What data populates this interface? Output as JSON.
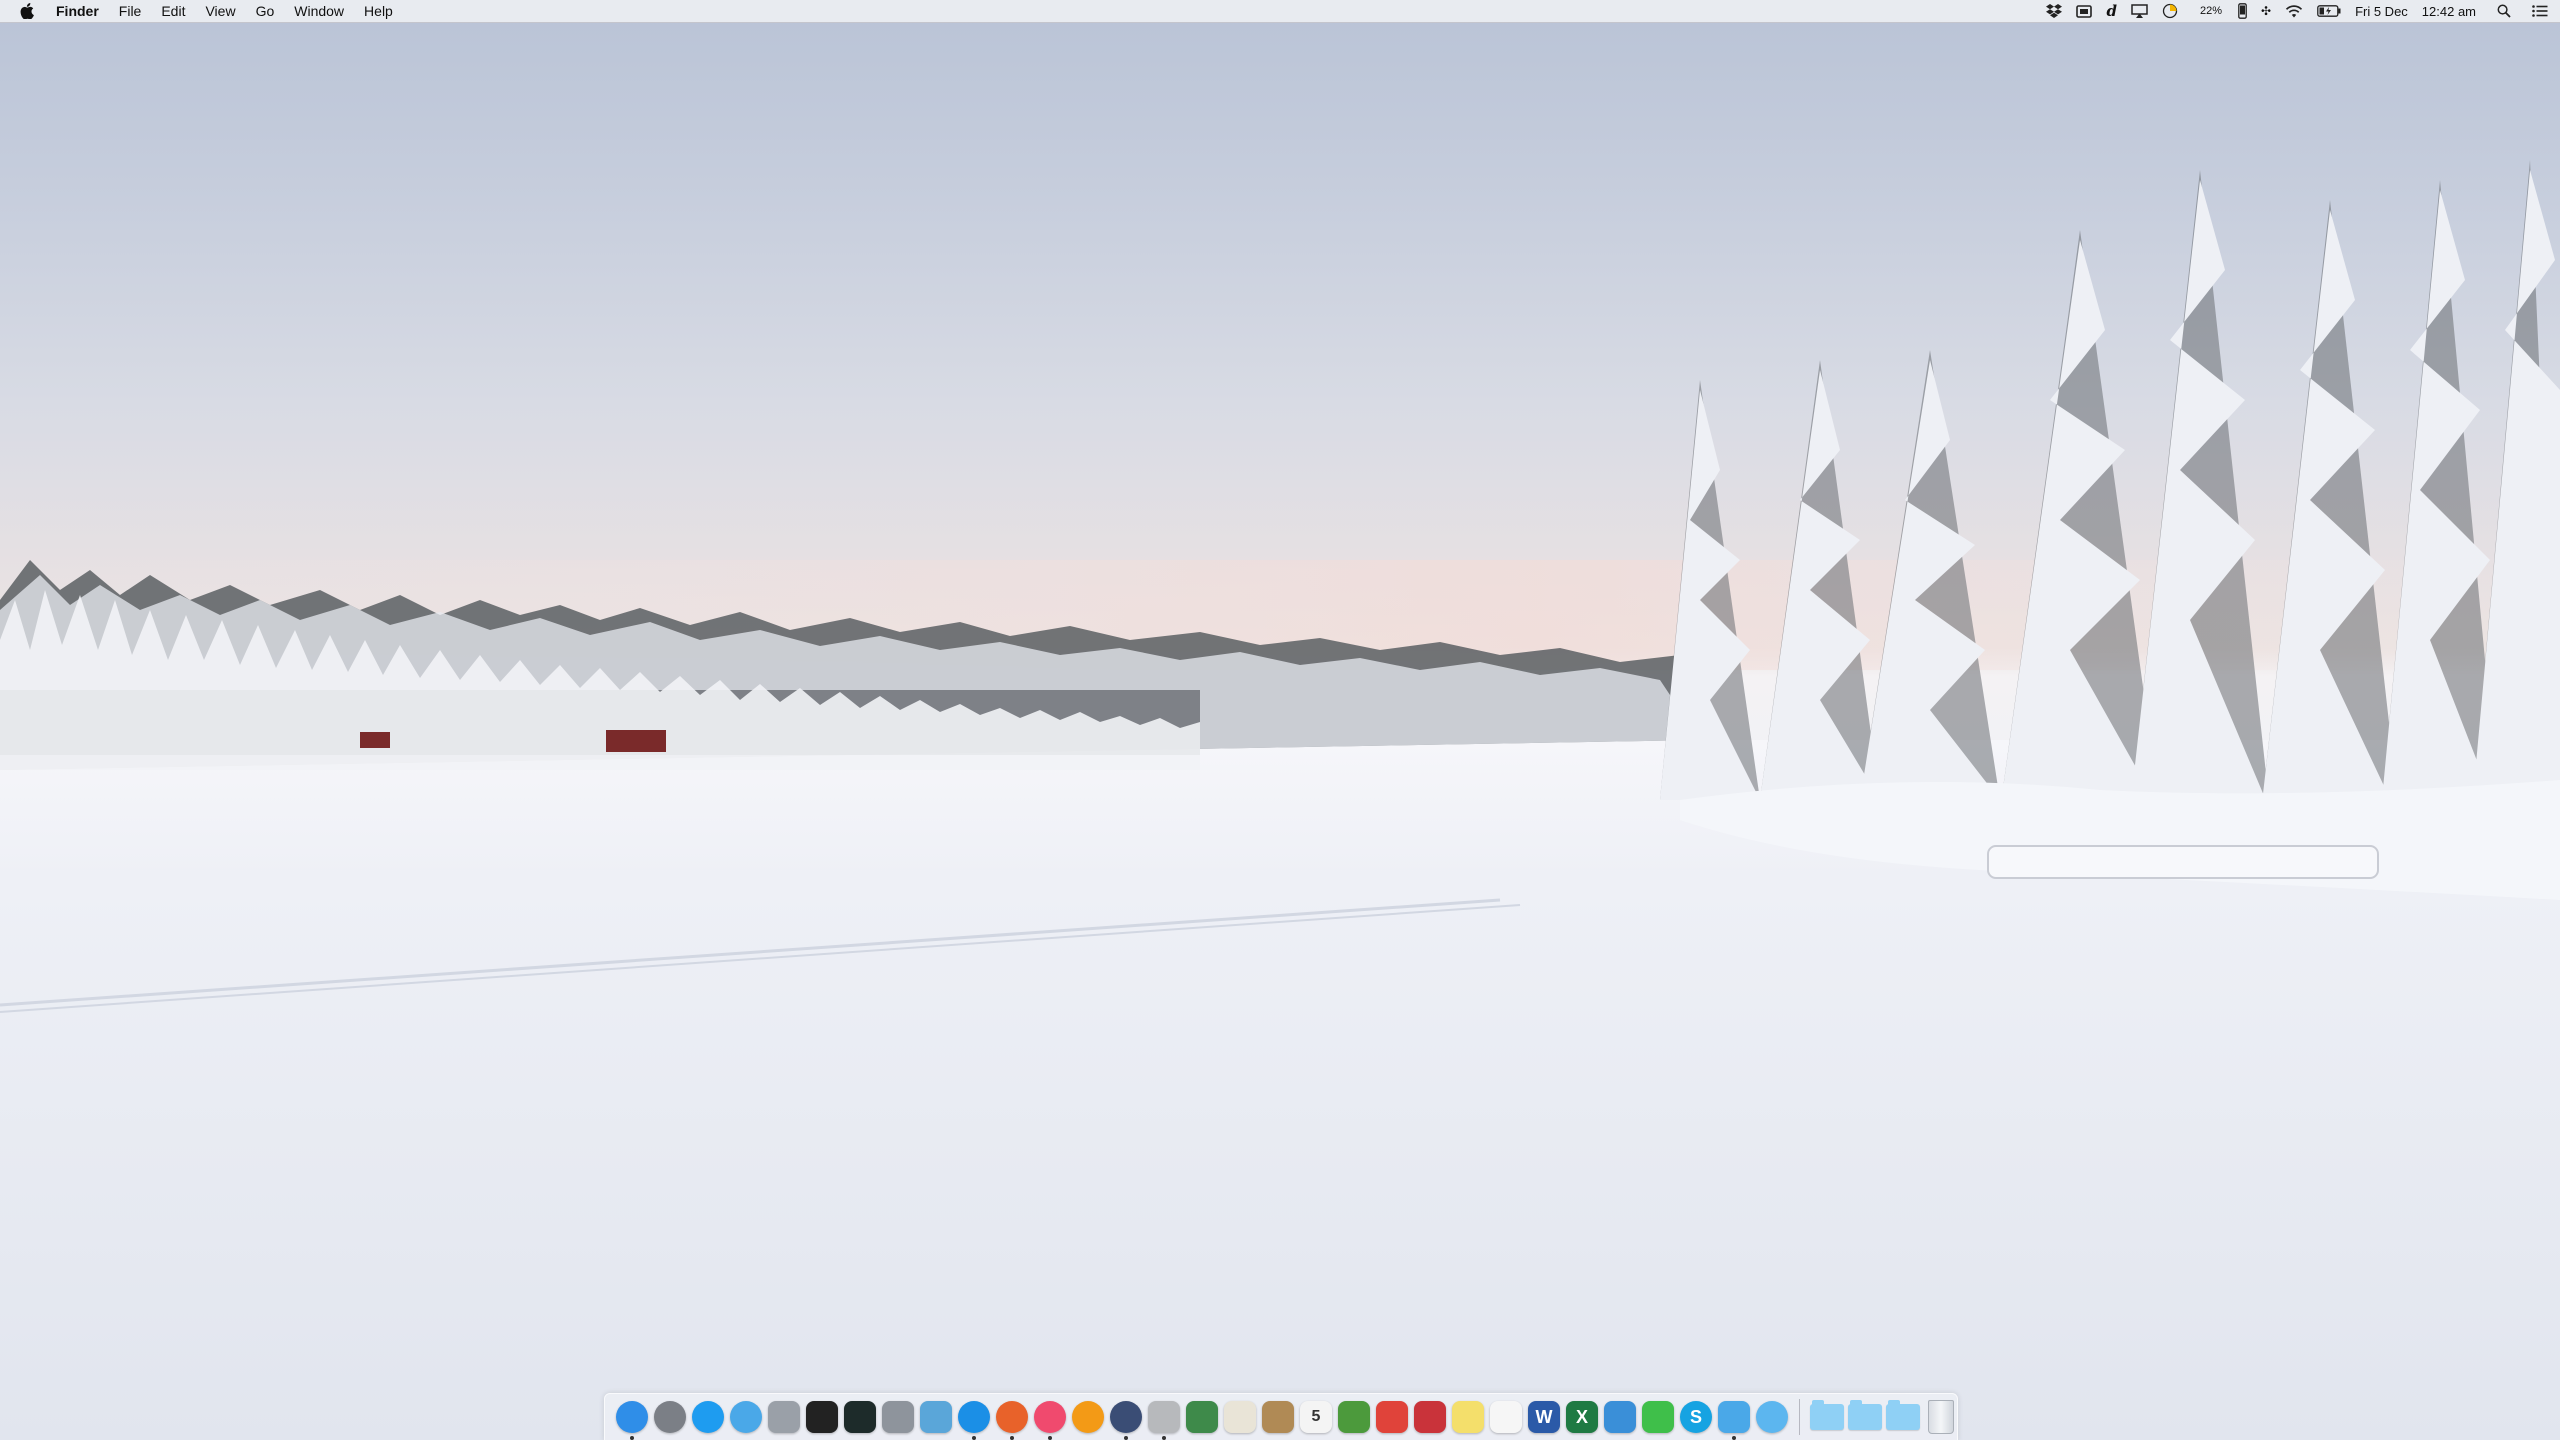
{
  "menubar": {
    "apple_icon": "apple-logo",
    "app_name": "Finder",
    "menus": [
      "File",
      "Edit",
      "View",
      "Go",
      "Window",
      "Help"
    ],
    "status": {
      "battery_percent": "22%",
      "date": "Fri 5 Dec",
      "time": "12:42 am",
      "icons": [
        "dropbox-icon",
        "screen-icon",
        "deezer-icon",
        "airplay-icon",
        "timer-icon",
        "phone-icon",
        "bluetooth-icon",
        "wifi-icon",
        "battery-icon",
        "spotlight-icon",
        "notification-center-icon"
      ]
    }
  },
  "dock": {
    "apps": [
      {
        "name": "finder",
        "running": true,
        "color": "#2f8ee8"
      },
      {
        "name": "system-preferences",
        "running": false,
        "color": "#7b7f86"
      },
      {
        "name": "app-store",
        "running": false,
        "color": "#1e9cf0"
      },
      {
        "name": "wifi-diagnostics",
        "running": false,
        "color": "#4aa8e8"
      },
      {
        "name": "printer",
        "running": false,
        "color": "#9aa0a8"
      },
      {
        "name": "terminal",
        "running": false,
        "color": "#222222"
      },
      {
        "name": "activity-monitor",
        "running": false,
        "color": "#1d2b2a"
      },
      {
        "name": "system-information",
        "running": false,
        "color": "#8e949c"
      },
      {
        "name": "preview",
        "running": false,
        "color": "#5aa6d9"
      },
      {
        "name": "safari",
        "running": true,
        "color": "#1b8fe6"
      },
      {
        "name": "firefox",
        "running": true,
        "color": "#e8622a"
      },
      {
        "name": "itunes",
        "running": true,
        "color": "#f04a6e"
      },
      {
        "name": "ibooks",
        "running": false,
        "color": "#f39a16"
      },
      {
        "name": "quicktime",
        "running": true,
        "color": "#3a4d75"
      },
      {
        "name": "script-editor",
        "running": true,
        "color": "#b7b9bc"
      },
      {
        "name": "photo-tool",
        "running": false,
        "color": "#3e8a4a"
      },
      {
        "name": "textedit",
        "running": false,
        "color": "#e9e4d7"
      },
      {
        "name": "contacts",
        "running": false,
        "color": "#b08a55"
      },
      {
        "name": "calendar",
        "running": false,
        "color": "#f4f4f4",
        "label": "5"
      },
      {
        "name": "vpn-app",
        "running": false,
        "color": "#4c9a3c"
      },
      {
        "name": "parallels",
        "running": false,
        "color": "#e0433a"
      },
      {
        "name": "pen-app",
        "running": false,
        "color": "#c9333a"
      },
      {
        "name": "stickies",
        "running": false,
        "color": "#f4df6b"
      },
      {
        "name": "notes",
        "running": false,
        "color": "#f6f6f6"
      },
      {
        "name": "word",
        "running": false,
        "color": "#2b5aa8",
        "label": "W"
      },
      {
        "name": "excel",
        "running": false,
        "color": "#1f7a43",
        "label": "X"
      },
      {
        "name": "keynote",
        "running": false,
        "color": "#3a8fd8"
      },
      {
        "name": "facetime",
        "running": false,
        "color": "#3fbf4a"
      },
      {
        "name": "skype",
        "running": false,
        "color": "#16a3e2",
        "label": "S"
      },
      {
        "name": "twitter",
        "running": true,
        "color": "#4aa8e8"
      },
      {
        "name": "messages",
        "running": false,
        "color": "#5cb6ef"
      }
    ],
    "stacks": [
      "downloads-folder",
      "applications-folder",
      "documents-folder"
    ],
    "trash": "trash-icon"
  }
}
